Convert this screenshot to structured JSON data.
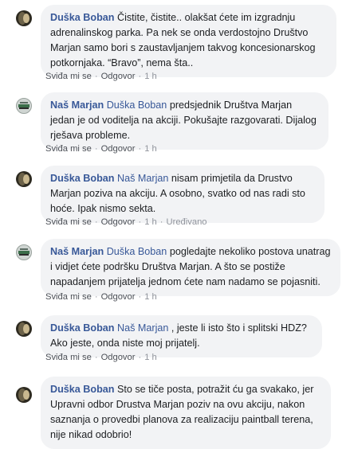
{
  "comments": [
    {
      "author": "Duška Boban",
      "tag": "",
      "text": "Čistite, čistite.. olakšat ćete im izgradnju adrenalinskog parka. Pa nek se onda verdostojno Društvo Marjan samo bori s zaustavljanjem takvog koncesionarskog potkornjaka. “Bravo”, nema šta..",
      "like": "Sviđa mi se",
      "reply": "Odgovor",
      "time": "1 h",
      "edited": ""
    },
    {
      "author": "Naš Marjan",
      "tag": "Duška Boban",
      "text": "predsjednik Društva Marjan jedan je od voditelja na akciji. Pokušajte razgovarati. Dijalog rješava probleme.",
      "like": "Sviđa mi se",
      "reply": "Odgovor",
      "time": "1 h",
      "edited": ""
    },
    {
      "author": "Duška Boban",
      "tag": "Naš Marjan",
      "text": "nisam primjetila da Drustvo Marjan poziva na akciju. A osobno, svatko od nas radi sto hoće. Ipak nismo sekta.",
      "like": "Sviđa mi se",
      "reply": "Odgovor",
      "time": "1 h",
      "edited": "Uređivano"
    },
    {
      "author": "Naš Marjan",
      "tag": "Duška Boban",
      "text": "pogledajte nekoliko postova unatrag i vidjet ćete podršku Društva Marjan. A što se postiže napadanjem prijatelja jednom ćete nam nadamo se pojasniti.",
      "like": "Sviđa mi se",
      "reply": "Odgovor",
      "time": "1 h",
      "edited": ""
    },
    {
      "author": "Duška Boban",
      "tag": "Naš Marjan",
      "text": ", jeste li isto što i splitski HDZ? Ako jeste, onda niste moj prijatelj.",
      "like": "Sviđa mi se",
      "reply": "Odgovor",
      "time": "1 h",
      "edited": ""
    },
    {
      "author": "Duška Boban",
      "tag": "",
      "text": "Sto se tiče posta, potražit ću ga svakako, jer Upravni odbor Drustva Marjan poziv na ovu akciju, nakon saznanja o provedbi planova za realizaciju paintball terena, nije nikad odobrio!",
      "like": "",
      "reply": "",
      "time": "",
      "edited": ""
    }
  ]
}
